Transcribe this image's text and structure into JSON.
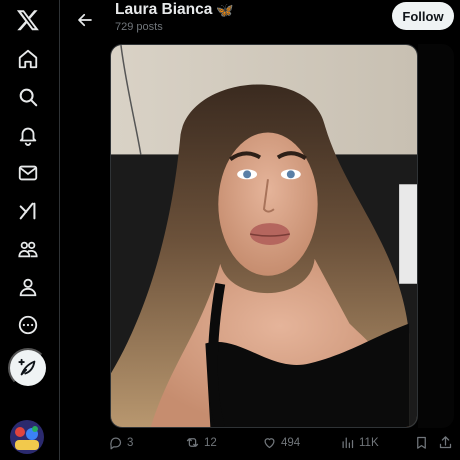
{
  "nav": {
    "items": [
      {
        "icon": "x-logo-icon"
      },
      {
        "icon": "home-icon"
      },
      {
        "icon": "search-icon"
      },
      {
        "icon": "bell-icon"
      },
      {
        "icon": "mail-icon"
      },
      {
        "icon": "grok-icon"
      },
      {
        "icon": "communities-icon"
      },
      {
        "icon": "profile-icon"
      },
      {
        "icon": "more-icon"
      }
    ],
    "post_button_icon": "compose-feather-icon"
  },
  "header": {
    "name": "Laura Bianca",
    "name_emoji": "🦋",
    "post_count": "729 posts",
    "follow_label": "Follow"
  },
  "actions": {
    "replies": "3",
    "reposts": "12",
    "likes": "494",
    "views": "11K"
  },
  "colors": {
    "background": "#000000",
    "text_primary": "#e7e9ea",
    "text_secondary": "#71767b",
    "button_bg": "#eff3f4",
    "border": "#2f3336"
  }
}
